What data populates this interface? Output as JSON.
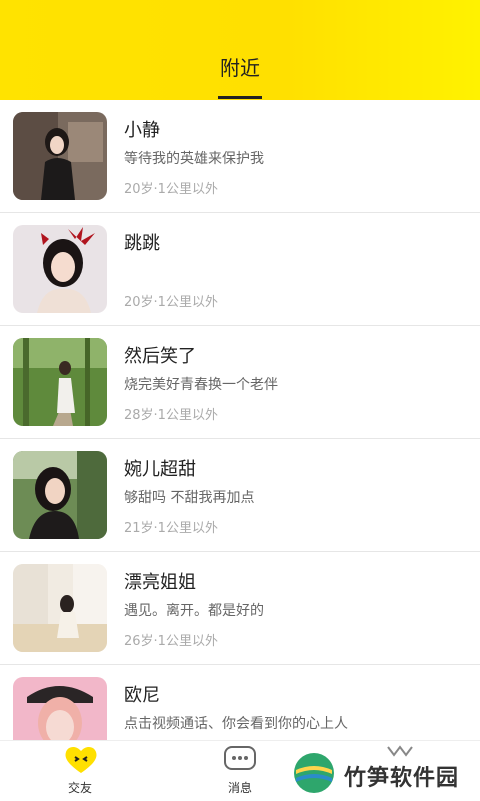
{
  "header": {
    "tab_label": "附近"
  },
  "items": [
    {
      "name": "小静",
      "desc": "等待我的英雄来保护我",
      "meta": "20岁·1公里以外"
    },
    {
      "name": "跳跳",
      "desc": "",
      "meta": "20岁·1公里以外"
    },
    {
      "name": "然后笑了",
      "desc": "烧完美好青春换一个老伴",
      "meta": "28岁·1公里以外"
    },
    {
      "name": "婉儿超甜",
      "desc": "够甜吗 不甜我再加点",
      "meta": "21岁·1公里以外"
    },
    {
      "name": "漂亮姐姐",
      "desc": "遇见。离开。都是好的",
      "meta": "26岁·1公里以外"
    },
    {
      "name": "欧尼",
      "desc": "点击视频通话、你会看到你的心上人",
      "meta": ""
    }
  ],
  "tabbar": {
    "friends_label": "交友",
    "messages_label": "消息"
  },
  "watermark": {
    "text": "竹笋软件园"
  },
  "colors": {
    "accent": "#ffe300",
    "text": "#222222",
    "muted": "#aaaaaa"
  }
}
